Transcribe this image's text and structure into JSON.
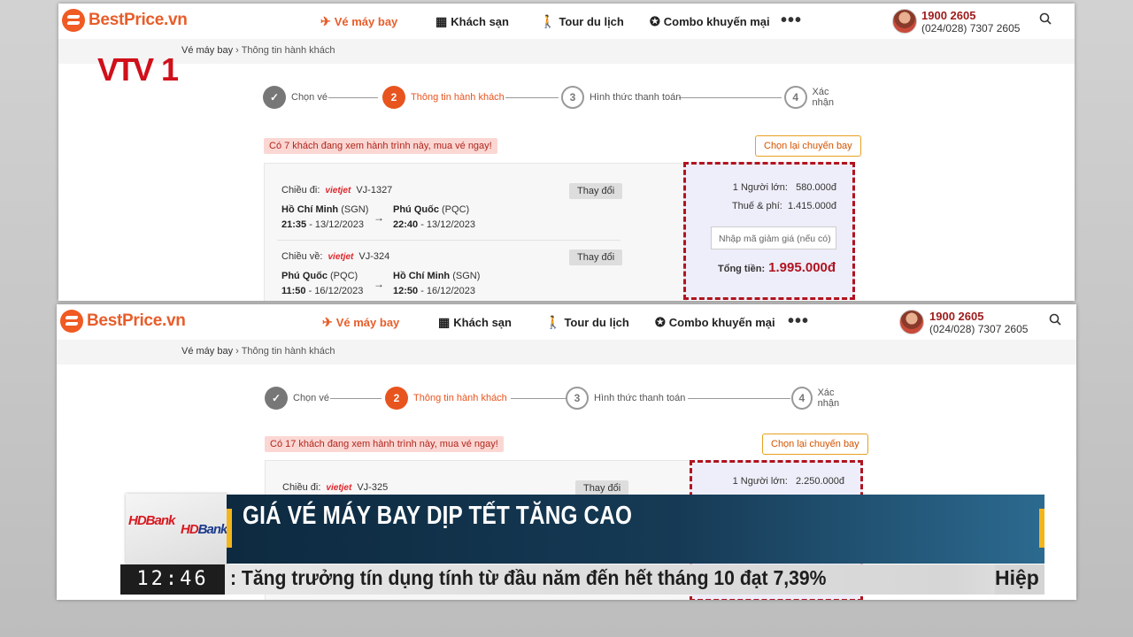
{
  "colors": {
    "brand_orange": "#e85d2a",
    "price_red": "#b01420",
    "alert_bg": "#fbd7d3",
    "headline_gold": "#f3b51c"
  },
  "header": {
    "logo_text": "BestPrice.vn",
    "nav": [
      {
        "label": "Vé máy bay",
        "icon": "plane-icon"
      },
      {
        "label": "Khách sạn",
        "icon": "hotel-icon"
      },
      {
        "label": "Tour du lịch",
        "icon": "traveler-icon"
      },
      {
        "label": "Combo khuyến mại",
        "icon": "ticket-icon"
      }
    ],
    "more": "•••",
    "hotline": "1900 2605",
    "phone": "(024/028) 7307 2605"
  },
  "breadcrumb": {
    "home": "Vé máy bay",
    "separator": "›",
    "current": "Thông tin hành khách"
  },
  "steps": [
    {
      "num": "✓",
      "label": "Chọn vé"
    },
    {
      "num": "2",
      "label": "Thông tin hành khách"
    },
    {
      "num": "3",
      "label": "Hình thức thanh toán"
    },
    {
      "num": "4",
      "label": "Xác nhận"
    }
  ],
  "shot1": {
    "alert": "Có 7 khách đang xem hành trình này, mua vé ngay!",
    "reselect": "Chọn lại chuyến bay",
    "outbound": {
      "label": "Chiều đi:",
      "airline": "vietjet",
      "flight": "VJ-1327",
      "change": "Thay đổi",
      "from_city": "Hồ Chí Minh",
      "from_code": "(SGN)",
      "from_time": "21:35",
      "from_date": "- 13/12/2023",
      "to_city": "Phú Quốc",
      "to_code": "(PQC)",
      "to_time": "22:40",
      "to_date": "- 13/12/2023"
    },
    "return": {
      "label": "Chiều về:",
      "airline": "vietjet",
      "flight": "VJ-324",
      "change": "Thay đổi",
      "from_city": "Phú Quốc",
      "from_code": "(PQC)",
      "from_time": "11:50",
      "from_date": "- 16/12/2023",
      "to_city": "Hồ Chí Minh",
      "to_code": "(SGN)",
      "to_time": "12:50",
      "to_date": "- 16/12/2023"
    },
    "price": {
      "adult_label": "1 Người lớn:",
      "adult_value": "580.000đ",
      "tax_label": "Thuế & phí:",
      "tax_value": "1.415.000đ",
      "promo_placeholder": "Nhập mã giảm giá (nếu có)",
      "total_label": "Tổng tiền:",
      "total_value": "1.995.000đ"
    }
  },
  "shot2": {
    "alert": "Có 17 khách đang xem hành trình này, mua vé ngay!",
    "reselect": "Chọn lại chuyến bay",
    "outbound": {
      "label": "Chiều đi:",
      "airline": "vietjet",
      "flight": "VJ-325",
      "change": "Thay đổi"
    },
    "price": {
      "adult_label": "1 Người lớn:",
      "adult_value": "2.250.000đ"
    }
  },
  "broadcast": {
    "channel": "VTV1",
    "sponsor": "HDBank",
    "headline": "GIÁ VÉ MÁY BAY DỊP TẾT TĂNG CAO",
    "clock": "12:46",
    "ticker": ": Tăng trưởng tín dụng tính từ đầu năm đến hết tháng 10 đạt 7,39%",
    "ticker_next": "Hiệp"
  }
}
